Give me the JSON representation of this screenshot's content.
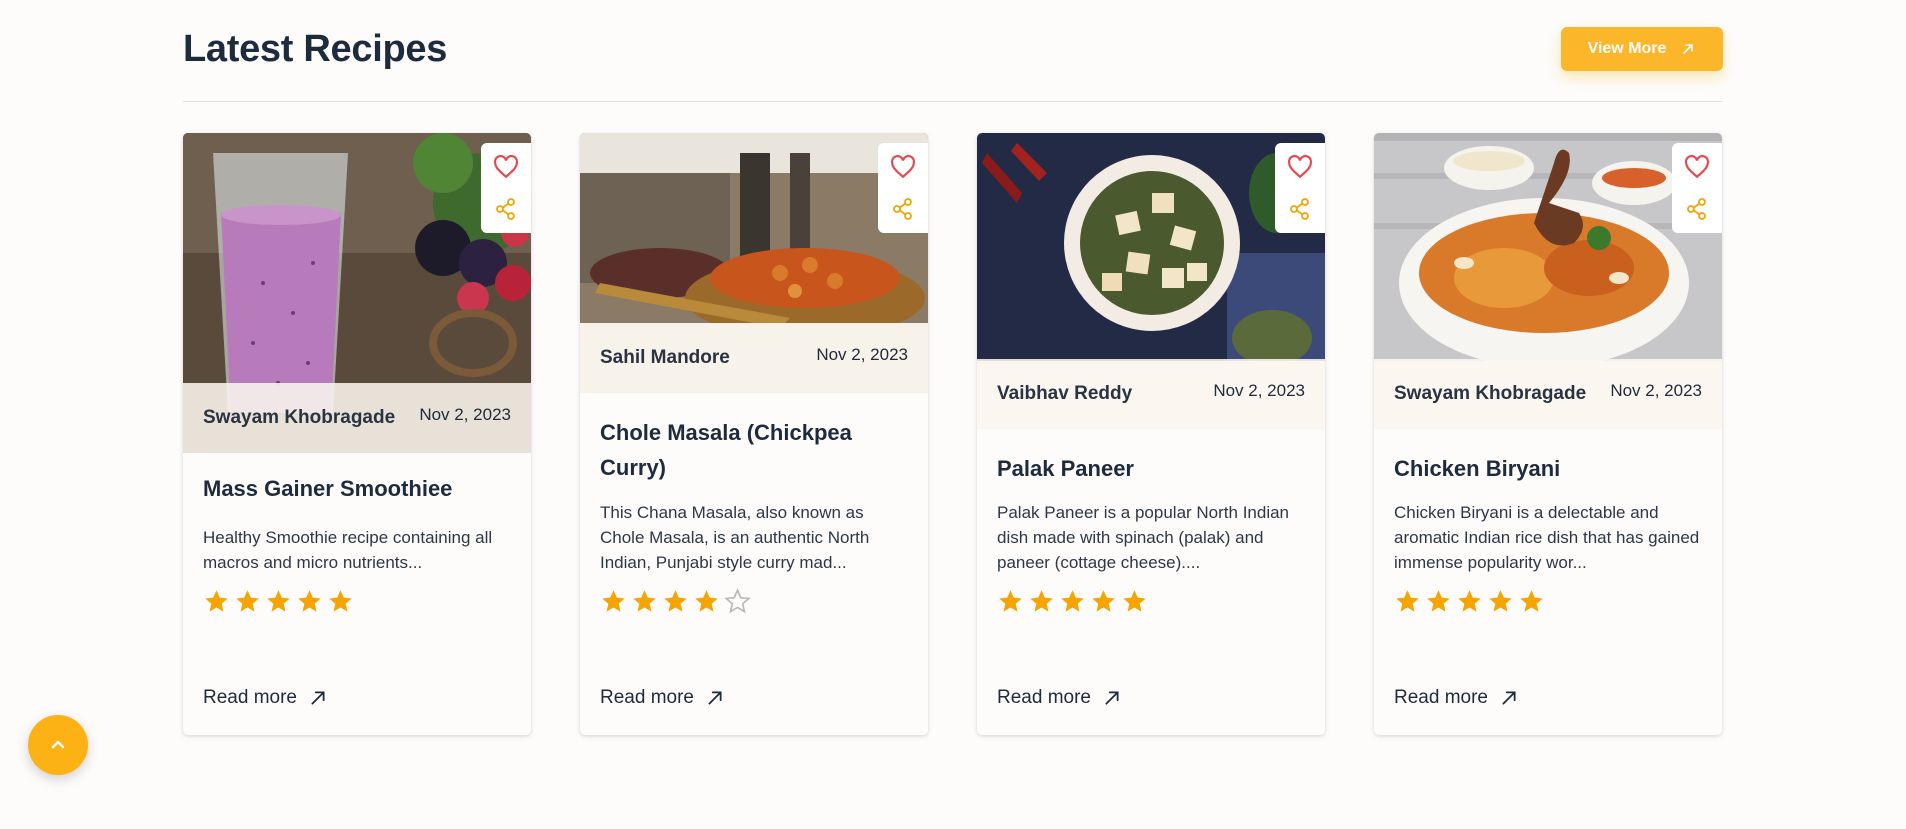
{
  "section": {
    "title": "Latest Recipes",
    "view_more_label": "View More"
  },
  "cards": [
    {
      "author": "Swayam Khobragade",
      "date": "Nov 2, 2023",
      "title": "Mass Gainer Smoothiee",
      "description": "Healthy Smoothie recipe containing all macros and micro nutrients...",
      "rating": 5,
      "read_more": "Read more"
    },
    {
      "author": "Sahil Mandore",
      "date": "Nov 2, 2023",
      "title": "Chole Masala (Chickpea Curry)",
      "description": "This Chana Masala, also known as Chole Masala, is an authentic North Indian, Punjabi style curry mad...",
      "rating": 4,
      "read_more": "Read more"
    },
    {
      "author": "Vaibhav Reddy",
      "date": "Nov 2, 2023",
      "title": "Palak Paneer",
      "description": "Palak Paneer is a popular North Indian dish made with spinach (palak) and paneer (cottage cheese)....",
      "rating": 5,
      "read_more": "Read more"
    },
    {
      "author": "Swayam Khobragade",
      "date": "Nov 2, 2023",
      "title": "Chicken Biryani",
      "description": "Chicken Biryani is a delectable and aromatic Indian rice dish that has gained immense popularity wor...",
      "rating": 5,
      "read_more": "Read more"
    }
  ],
  "colors": {
    "accent": "#fcb629",
    "star": "#f6a400",
    "star_empty": "#b8b8b8",
    "heart": "#e5484d",
    "share": "#f0a500"
  },
  "icons": [
    "heart-icon",
    "share-icon",
    "star-icon",
    "arrow-up-right-icon",
    "chevron-up-icon"
  ]
}
